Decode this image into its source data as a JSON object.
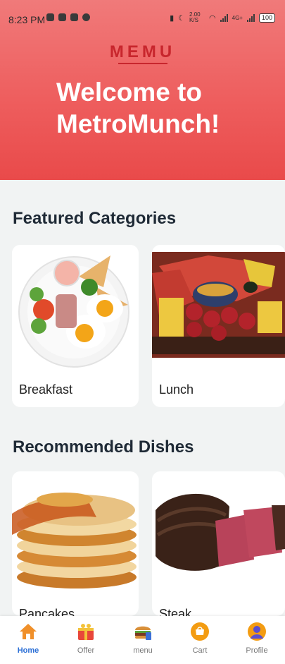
{
  "status_bar": {
    "time": "8:23 PM",
    "speed": "2.00 K/S",
    "network": "4G+",
    "battery": "100"
  },
  "header": {
    "logo_text": "MEMU",
    "welcome": "Welcome to MetroMunch!"
  },
  "featured": {
    "title": "Featured Categories",
    "items": [
      {
        "label": "Breakfast"
      },
      {
        "label": "Lunch"
      }
    ]
  },
  "recommended": {
    "title": "Recommended Dishes",
    "items": [
      {
        "label": "Pancakes"
      },
      {
        "label": "Steak"
      }
    ]
  },
  "nav": {
    "items": [
      {
        "label": "Home",
        "icon": "home-icon",
        "active": true
      },
      {
        "label": "Offer",
        "icon": "gift-icon"
      },
      {
        "label": "menu",
        "icon": "burger-icon"
      },
      {
        "label": "Cart",
        "icon": "cart-icon"
      },
      {
        "label": "Profile",
        "icon": "profile-icon"
      }
    ]
  },
  "colors": {
    "hero": "#ee5e5e",
    "logo": "#c8262d",
    "active_nav": "#2b6fd6"
  }
}
